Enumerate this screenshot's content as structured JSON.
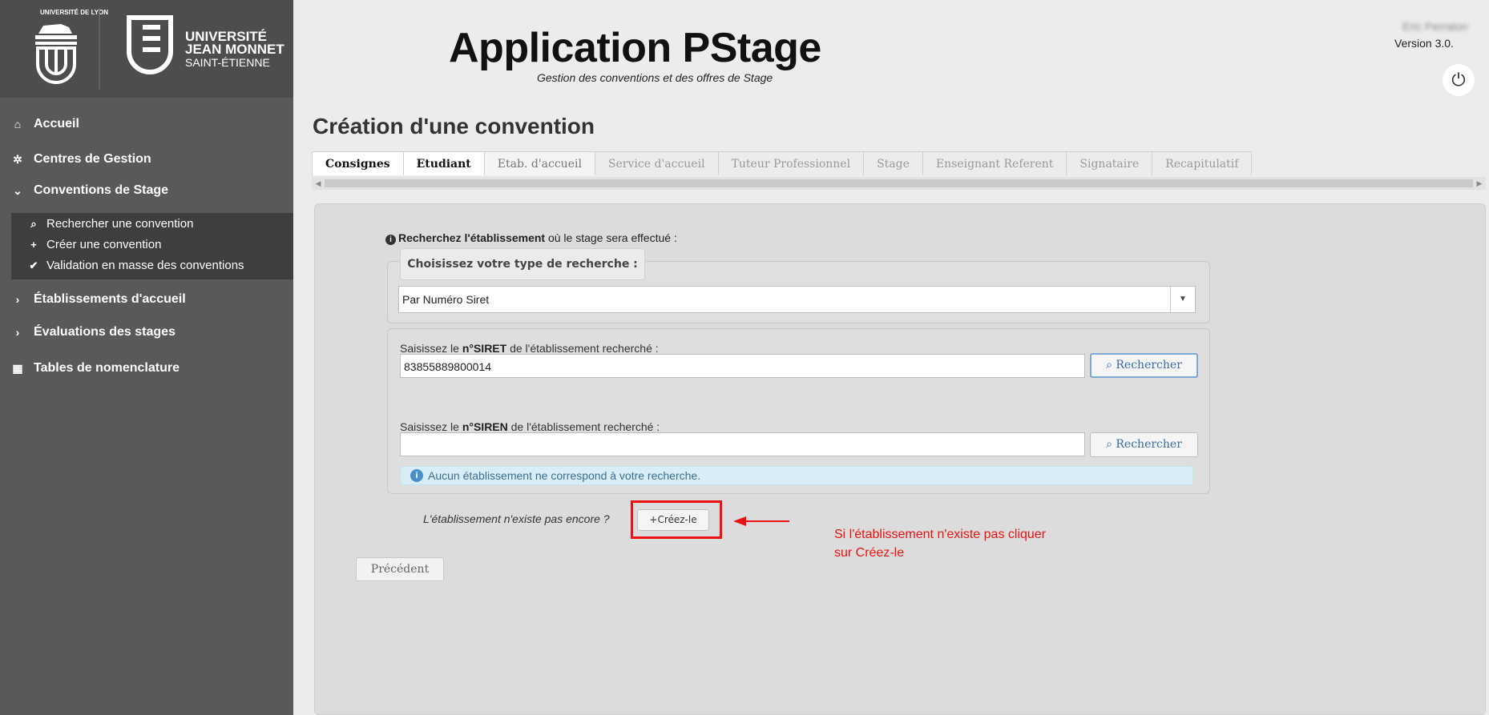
{
  "sidebar": {
    "logo": {
      "lyon_text": "UNIVERSITÉ DE LYON",
      "ujm_line1": "UNIVERSITÉ",
      "ujm_line2": "JEAN MONNET",
      "ujm_line3": "SAINT-ÉTIENNE"
    },
    "items": [
      {
        "label": "Accueil",
        "icon": "home-icon"
      },
      {
        "label": "Centres de Gestion",
        "icon": "gear-icon"
      },
      {
        "label": "Conventions de Stage",
        "icon": "chevron-down-icon"
      },
      {
        "label": "Établissements d'accueil",
        "icon": "chevron-right-icon"
      },
      {
        "label": "Évaluations des stages",
        "icon": "chevron-right-icon"
      },
      {
        "label": "Tables de nomenclature",
        "icon": "table-icon"
      }
    ],
    "subitems": [
      {
        "label": "Rechercher une convention",
        "icon": "search-icon"
      },
      {
        "label": "Créer une convention",
        "icon": "plus-icon"
      },
      {
        "label": "Validation en masse des conventions",
        "icon": "check-icon"
      }
    ]
  },
  "header": {
    "title": "Application PStage",
    "subtitle": "Gestion des conventions et des offres de Stage",
    "user_name": "Eric Perraton",
    "version": "Version 3.0."
  },
  "page": {
    "title": "Création d'une convention"
  },
  "tabs": [
    {
      "label": "Consignes",
      "state": "active"
    },
    {
      "label": "Etudiant",
      "state": "active"
    },
    {
      "label": "Etab. d'accueil",
      "state": "partial"
    },
    {
      "label": "Service d'accueil",
      "state": "disabled"
    },
    {
      "label": "Tuteur Professionnel",
      "state": "disabled"
    },
    {
      "label": "Stage",
      "state": "disabled"
    },
    {
      "label": "Enseignant Referent",
      "state": "disabled"
    },
    {
      "label": "Signataire",
      "state": "disabled"
    },
    {
      "label": "Recapitulatif",
      "state": "disabled"
    }
  ],
  "form": {
    "intro_bold": "Recherchez l'établissement",
    "intro_rest": " où le stage sera effectué :",
    "type_legend": "Choisissez votre type de recherche :",
    "type_value": "Par Numéro Siret",
    "siret_label_pre": "Saisissez le ",
    "siret_label_bold": "n°SIRET",
    "siret_label_post": " de l'établissement recherché :",
    "siret_value": "83855889800014",
    "siren_label_pre": "Saisissez le ",
    "siren_label_bold": "n°SIREN",
    "siren_label_post": " de l'établissement recherché :",
    "siren_value": "",
    "search_button": "Rechercher",
    "alert": "Aucun établissement ne correspond à votre recherche.",
    "not_exist": "L'établissement n'existe pas encore ?",
    "create_button": "Créez-le",
    "prev_button": "Précédent"
  },
  "annotation": {
    "line1": "Si l'établissement n'existe pas cliquer",
    "line2": "sur Créez-le",
    "color": "#ee1111"
  }
}
